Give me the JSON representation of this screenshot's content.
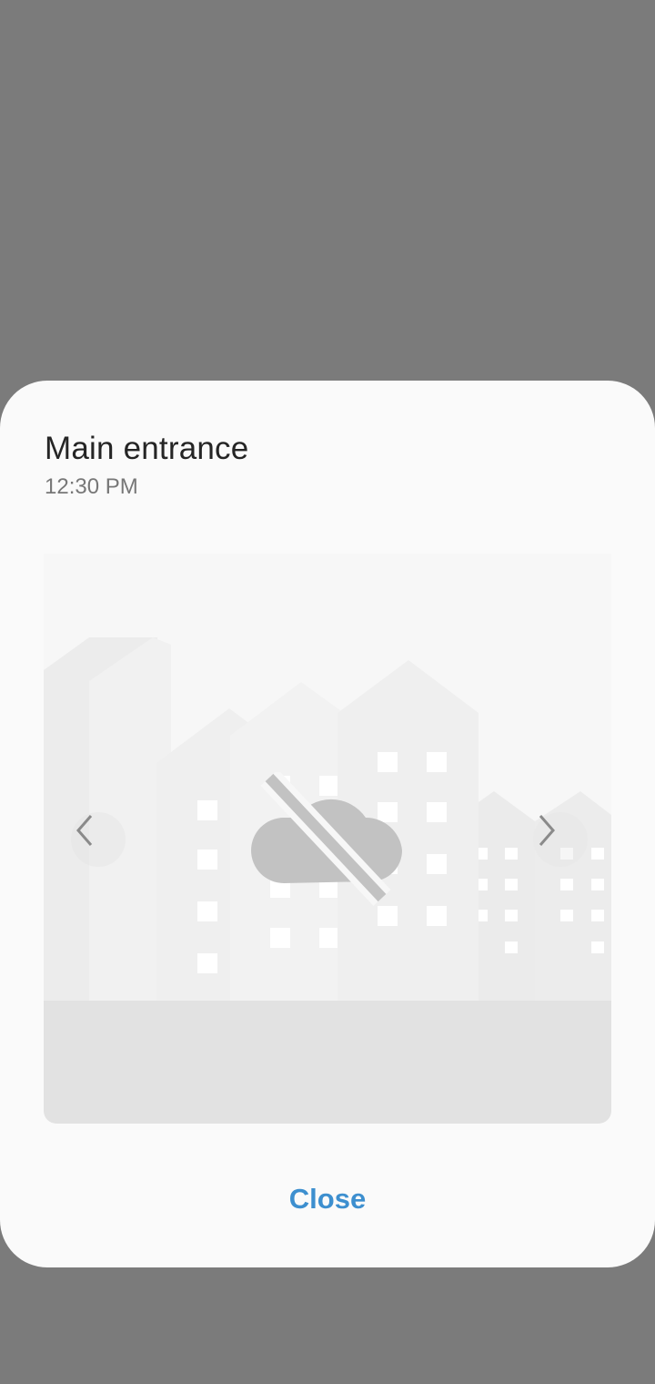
{
  "dialog": {
    "title": "Main entrance",
    "time": "12:30 PM",
    "close_label": "Close"
  },
  "preview": {
    "placeholder_icon": "cloud-off-icon",
    "prev_icon": "chevron-left-icon",
    "next_icon": "chevron-right-icon"
  },
  "colors": {
    "scrim": "#7b7b7b",
    "dialog_background": "#fafafa",
    "accent": "#3d8fcf"
  }
}
